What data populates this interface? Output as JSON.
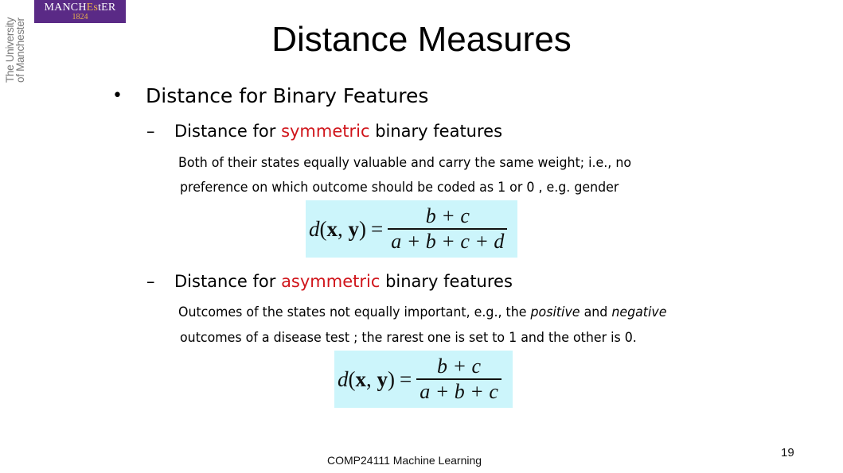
{
  "logo": {
    "wordmark_pre": "MANCH",
    "wordmark_accent": "Es",
    "wordmark_post": "tER",
    "year": "1824",
    "vertical_text_line1": "The University",
    "vertical_text_line2": "of Manchester",
    "colors": {
      "background": "#5a2a86",
      "accent": "#e8b04a"
    }
  },
  "slide": {
    "title": "Distance Measures",
    "bullet": {
      "symbol": "•",
      "label": "Distance for Binary Features"
    },
    "sections": [
      {
        "dash": "–",
        "heading_pre": "Distance for ",
        "heading_highlight": "symmetric",
        "heading_post": " binary features",
        "text_line1": "Both of their states equally valuable and carry the same weight; i.e.,  no",
        "text_line2": "preference on which outcome should be coded as 1 or 0 , e.g. gender",
        "formula": {
          "lhs_d": "d",
          "lhs_open": "(",
          "lhs_x": "x",
          "lhs_comma": ", ",
          "lhs_y": "y",
          "lhs_close": ")",
          "equals": "=",
          "numerator": "b + c",
          "denominator": "a + b + c + d"
        }
      },
      {
        "dash": "–",
        "heading_pre": "Distance for ",
        "heading_highlight": "asymmetric",
        "heading_post": " binary features",
        "text_line1_pre": "Outcomes of the states not equally important, e.g., the ",
        "text_line1_em1": "positive",
        "text_line1_mid": " and ",
        "text_line1_em2": "negative",
        "text_line2": "outcomes of a disease test ; the rarest one is set to 1 and the other is 0.",
        "formula": {
          "lhs_d": "d",
          "lhs_open": "(",
          "lhs_x": "x",
          "lhs_comma": ", ",
          "lhs_y": "y",
          "lhs_close": ")",
          "equals": "=",
          "numerator": "b + c",
          "denominator": "a + b + c"
        }
      }
    ],
    "highlight_color": "#d0151b",
    "formula_background": "#ccf5fb"
  },
  "footer": {
    "course": "COMP24111  Machine Learning",
    "page_number": "19"
  }
}
